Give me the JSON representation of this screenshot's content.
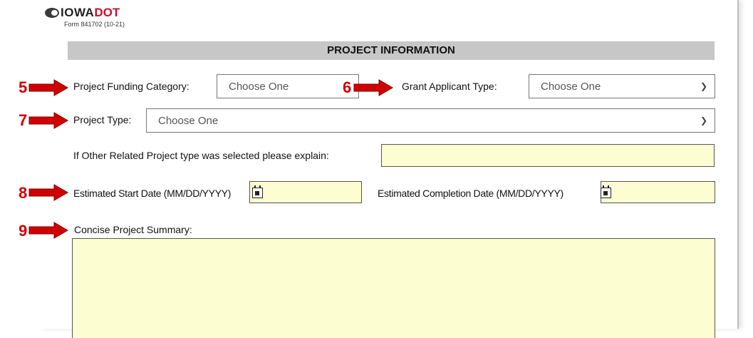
{
  "header": {
    "logo_iowa": "IOWA",
    "logo_dot": "DOT",
    "form_number": "Form 841702 (10-21)"
  },
  "section": {
    "title": "PROJECT INFORMATION"
  },
  "markers": [
    "5",
    "6",
    "7",
    "8",
    "9"
  ],
  "fields": {
    "funding_category": {
      "label": "Project Funding Category:",
      "value": "Choose One"
    },
    "grant_applicant_type": {
      "label": "Grant Applicant Type:",
      "value": "Choose One"
    },
    "project_type": {
      "label": "Project Type:",
      "value": "Choose One"
    },
    "other_explain": {
      "label": "If Other Related Project type was selected please explain:"
    },
    "start_date": {
      "label": "Estimated Start Date (MM/DD/YYYY)"
    },
    "completion_date": {
      "label": "Estimated Completion Date (MM/DD/YYYY)"
    },
    "summary": {
      "label": "Concise Project Summary:"
    }
  },
  "colors": {
    "annotation": "#d10000",
    "field_fill": "#fdfdd2",
    "banner": "#c7c7c7"
  }
}
